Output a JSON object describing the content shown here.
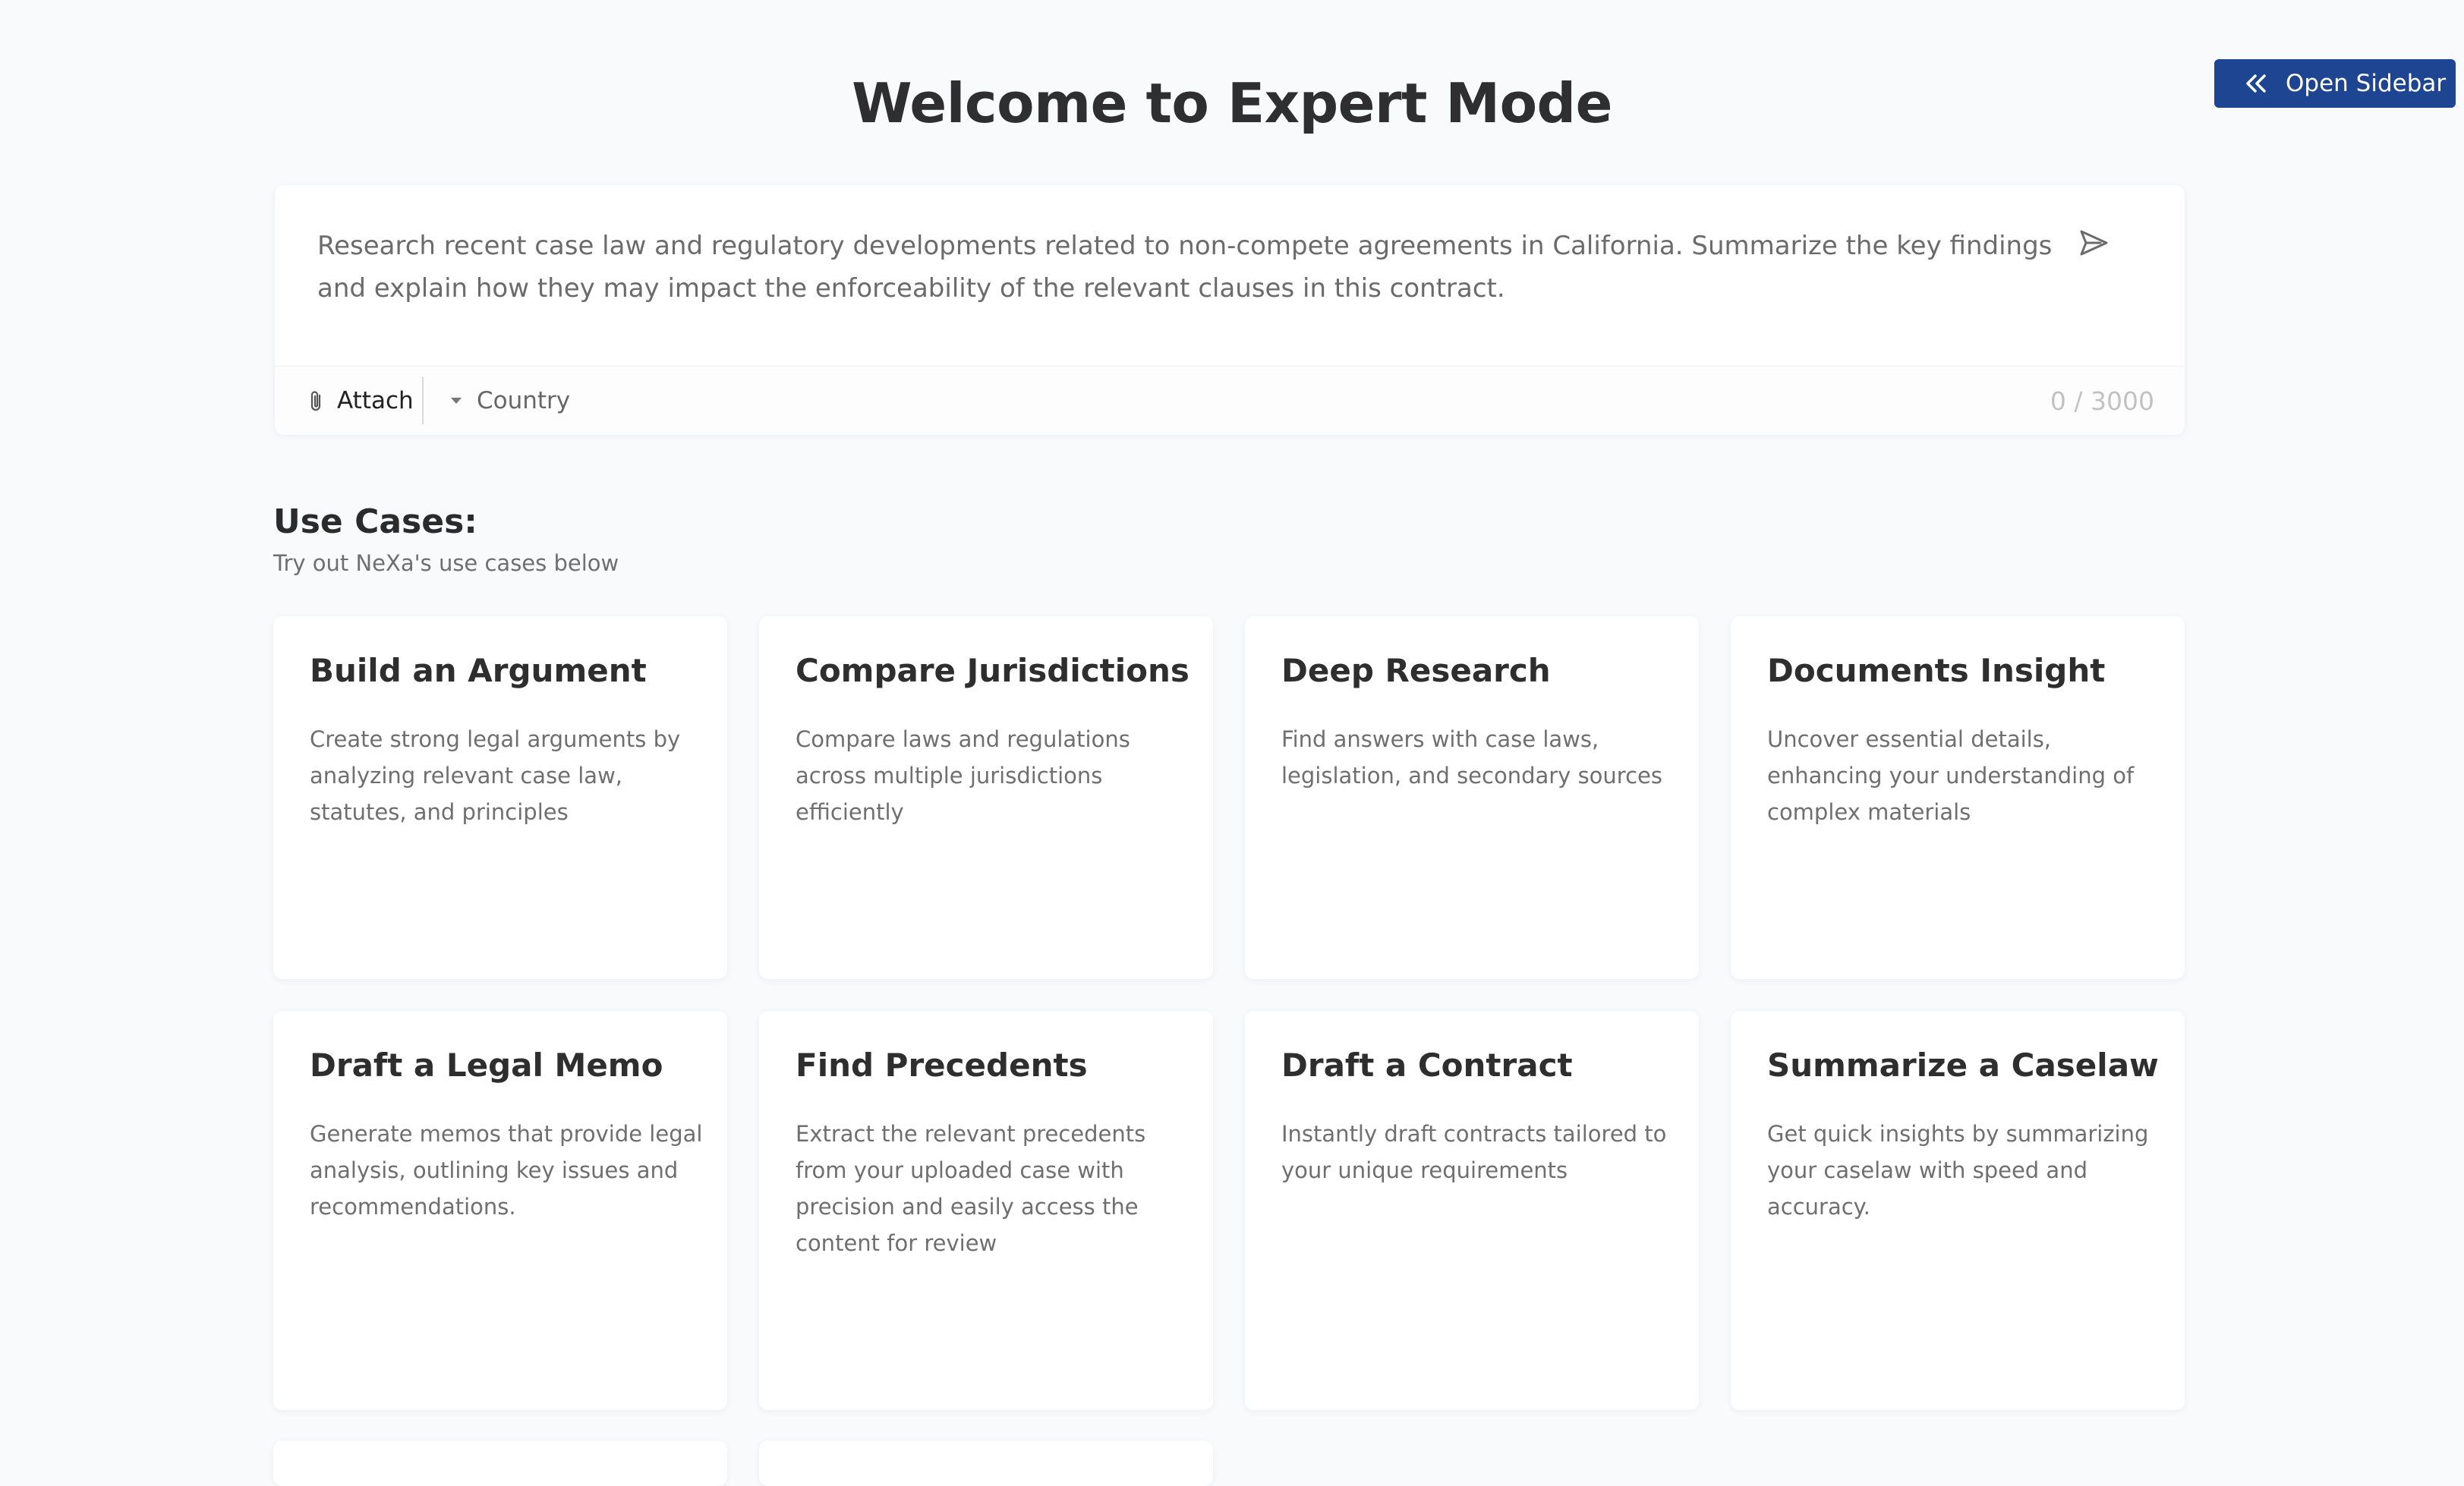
{
  "header": {
    "title": "Welcome to Expert Mode",
    "open_sidebar_label": "Open Sidebar"
  },
  "composer": {
    "prompt": "Research recent case law and regulatory developments related to non-compete agreements in California. Summarize the key findings and explain how they may impact the enforceability of the relevant clauses in this contract.",
    "attach_label": "Attach",
    "country_placeholder": "Country",
    "char_count": "0 / 3000"
  },
  "use_cases": {
    "heading": "Use Cases:",
    "subtitle": "Try out NeXa's use cases below",
    "cards": [
      {
        "title": "Build an Argument",
        "description": "Create strong legal arguments by analyzing relevant case law, statutes, and principles"
      },
      {
        "title": "Compare Jurisdictions",
        "description": "Compare laws and regulations across multiple jurisdictions efficiently"
      },
      {
        "title": "Deep Research",
        "description": "Find answers with case laws, legislation, and secondary sources"
      },
      {
        "title": "Documents Insight",
        "description": "Uncover essential details, enhancing your understanding of complex materials"
      },
      {
        "title": "Draft a Legal Memo",
        "description": "Generate memos that provide legal analysis, outlining key issues and recommendations."
      },
      {
        "title": "Find Precedents",
        "description": "Extract the relevant precedents from your uploaded case with precision and easily access the content for review"
      },
      {
        "title": "Draft a Contract",
        "description": "Instantly draft contracts tailored to your unique requirements"
      },
      {
        "title": "Summarize a Caselaw",
        "description": "Get quick insights by summarizing your caselaw with speed and accuracy."
      }
    ]
  },
  "icons": {
    "open_sidebar": "double-chevron-left-icon",
    "send": "send-icon",
    "attach": "paperclip-icon",
    "dropdown": "caret-down-icon"
  },
  "colors": {
    "accent": "#1d4592",
    "background": "#f8fafc",
    "card": "#ffffff"
  }
}
